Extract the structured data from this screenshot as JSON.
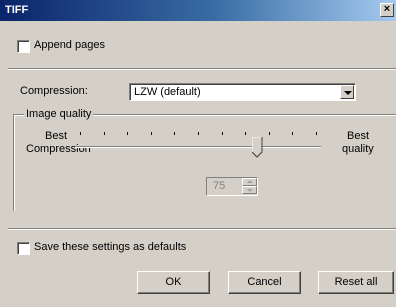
{
  "window": {
    "title": "TIFF",
    "close_glyph": "×"
  },
  "append_pages": {
    "label": "Append pages",
    "checked": false
  },
  "compression": {
    "label": "Compression:",
    "value": "LZW (default)"
  },
  "image_quality": {
    "group_label": "Image quality",
    "left_label_line1": "Best",
    "left_label_line2": "Compression",
    "right_label_line1": "Best",
    "right_label_line2": "quality",
    "value": "75",
    "slider_level_percent": 75,
    "tick_count": 11
  },
  "save_defaults": {
    "label": "Save these settings as defaults",
    "checked": false
  },
  "buttons": {
    "ok": "OK",
    "cancel": "Cancel",
    "reset": "Reset all"
  }
}
